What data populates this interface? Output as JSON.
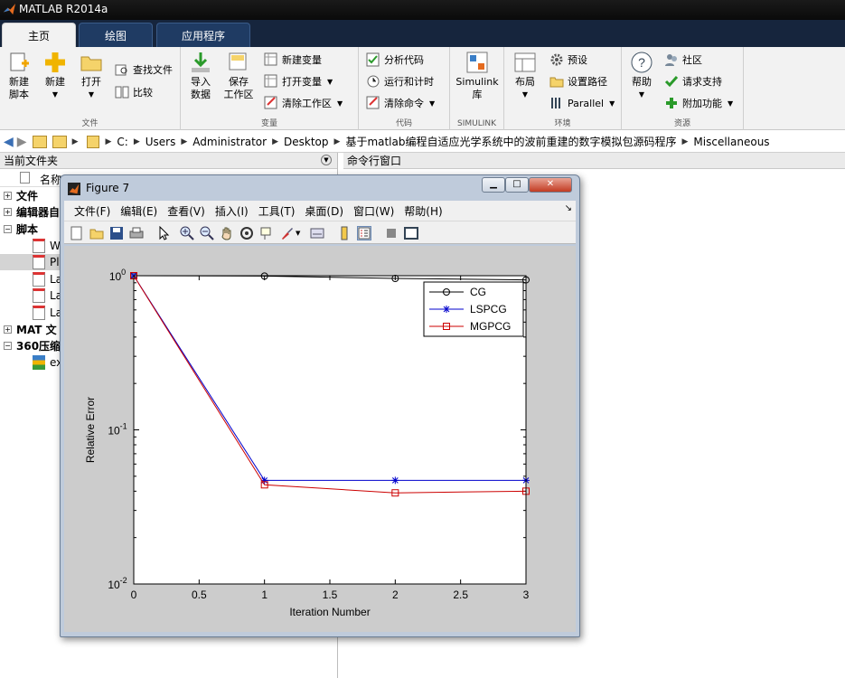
{
  "window": {
    "title": "MATLAB R2014a"
  },
  "tabs": [
    {
      "label": "主页"
    },
    {
      "label": "绘图"
    },
    {
      "label": "应用程序"
    }
  ],
  "ribbon": {
    "file": {
      "caption": "文件",
      "new_script": "新建\n脚本",
      "new": "新建",
      "open": "打开",
      "find_files": "查找文件",
      "compare": "比较"
    },
    "variable": {
      "caption": "变量",
      "import": "导入\n数据",
      "save_ws": "保存\n工作区",
      "new_var": "新建变量",
      "open_var": "打开变量",
      "clear_ws": "清除工作区"
    },
    "code": {
      "caption": "代码",
      "analyze": "分析代码",
      "run_time": "运行和计时",
      "clear_cmd": "清除命令"
    },
    "simulink": {
      "caption": "SIMULINK",
      "lib": "Simulink\n库"
    },
    "env": {
      "caption": "环境",
      "layout": "布局",
      "prefs": "预设",
      "set_path": "设置路径",
      "parallel": "Parallel"
    },
    "resources": {
      "caption": "资源",
      "help": "帮助",
      "community": "社区",
      "support": "请求支持",
      "addons": "附加功能"
    }
  },
  "address": {
    "crumbs": [
      "C:",
      "Users",
      "Administrator",
      "Desktop",
      "基于matlab编程自适应光学系统中的波前重建的数字模拟包源码程序",
      "Miscellaneous"
    ]
  },
  "panes": {
    "current_folder": "当前文件夹",
    "command_window": "命令行窗口",
    "name_col": "名称"
  },
  "tree": [
    {
      "label": "文件",
      "toggle": "+",
      "bold": true
    },
    {
      "label": "编辑器自",
      "toggle": "+",
      "bold": true
    },
    {
      "label": "脚本",
      "toggle": "-",
      "bold": true
    },
    {
      "label": "W",
      "toggle": "",
      "bold": false
    },
    {
      "label": "Pl",
      "toggle": "",
      "bold": false
    },
    {
      "label": "La",
      "toggle": "",
      "bold": false
    },
    {
      "label": "La",
      "toggle": "",
      "bold": false
    },
    {
      "label": "La",
      "toggle": "",
      "bold": false
    },
    {
      "label": "MAT 文",
      "toggle": "+",
      "bold": true
    },
    {
      "label": "360压缩",
      "toggle": "-",
      "bold": true
    },
    {
      "label": "ex",
      "toggle": "",
      "bold": false
    }
  ],
  "figure": {
    "title": "Figure 7",
    "menu": [
      "文件(F)",
      "编辑(E)",
      "查看(V)",
      "插入(I)",
      "工具(T)",
      "桌面(D)",
      "窗口(W)",
      "帮助(H)"
    ]
  },
  "chart_data": {
    "type": "line",
    "xlabel": "Iteration Number",
    "ylabel": "Relative Error",
    "xlim": [
      0,
      3
    ],
    "ylim": [
      0.01,
      1
    ],
    "yscale": "log",
    "xticks": [
      "0",
      "0.5",
      "1",
      "1.5",
      "2",
      "2.5",
      "3"
    ],
    "yticks": [
      {
        "base": "10",
        "exp": "0"
      },
      {
        "base": "10",
        "exp": "-1"
      },
      {
        "base": "10",
        "exp": "-2"
      }
    ],
    "x": [
      0,
      1,
      2,
      3
    ],
    "legend_position": "top-right",
    "series": [
      {
        "name": "CG",
        "values": [
          1.0,
          0.995,
          0.96,
          0.94
        ],
        "color": "#000000",
        "marker": "circle"
      },
      {
        "name": "LSPCG",
        "values": [
          1.0,
          0.047,
          0.047,
          0.047
        ],
        "color": "#0000cc",
        "marker": "star"
      },
      {
        "name": "MGPCG",
        "values": [
          1.0,
          0.044,
          0.039,
          0.04
        ],
        "color": "#cc0000",
        "marker": "square"
      }
    ]
  }
}
